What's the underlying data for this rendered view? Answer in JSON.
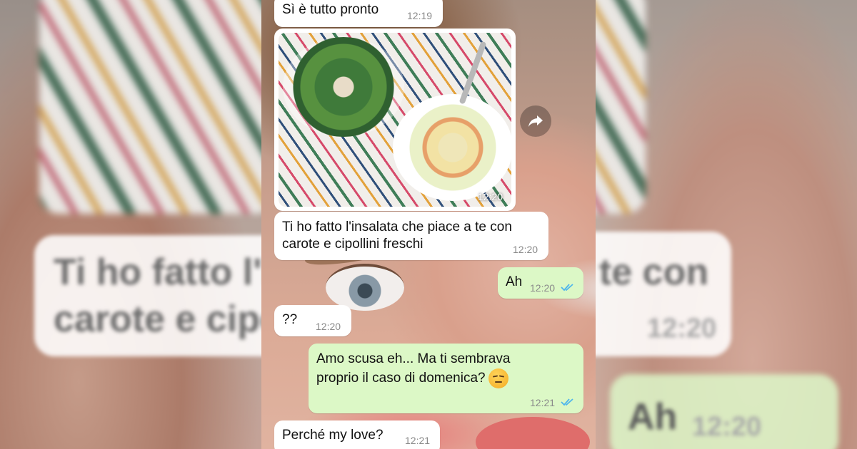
{
  "messages": [
    {
      "id": "m1",
      "direction": "incoming",
      "text": "Sì è tutto pronto",
      "time": "12:19"
    },
    {
      "id": "m2",
      "direction": "incoming",
      "type": "image",
      "image_subject": "two bowls of salad on colorful leaf-pattern tablecloth",
      "time": "12:20"
    },
    {
      "id": "m3",
      "direction": "incoming",
      "text_line1": "Ti ho fatto l'insalata che piace a te con",
      "text_line2": "carote e cipollini freschi",
      "time": "12:20"
    },
    {
      "id": "m4",
      "direction": "outgoing",
      "text": "Ah",
      "time": "12:20",
      "status": "read"
    },
    {
      "id": "m5",
      "direction": "incoming",
      "text": "??",
      "time": "12:20"
    },
    {
      "id": "m6",
      "direction": "outgoing",
      "text_line1": "Amo scusa eh... Ma ti sembrava",
      "text_line2": "proprio il caso di domenica?",
      "emoji": "unamused-face",
      "time": "12:21",
      "status": "read"
    },
    {
      "id": "m7",
      "direction": "incoming",
      "text": "Perché my love?",
      "time": "12:21"
    }
  ],
  "blurred_background": {
    "left_text_line1": "Ti ho fatto l'i",
    "left_text_line2": "carote e cipo",
    "right_text_line1": "te con",
    "right_time": "12:20",
    "right_out_text": "Ah",
    "right_out_time": "12:20"
  },
  "colors": {
    "incoming_bubble": "#ffffff",
    "outgoing_bubble": "#dcf8c6",
    "read_ticks": "#4fb6ec",
    "timestamp": "#8a8a8a"
  },
  "icons": {
    "share": "forward-arrow-icon",
    "ticks": "double-check-icon"
  }
}
